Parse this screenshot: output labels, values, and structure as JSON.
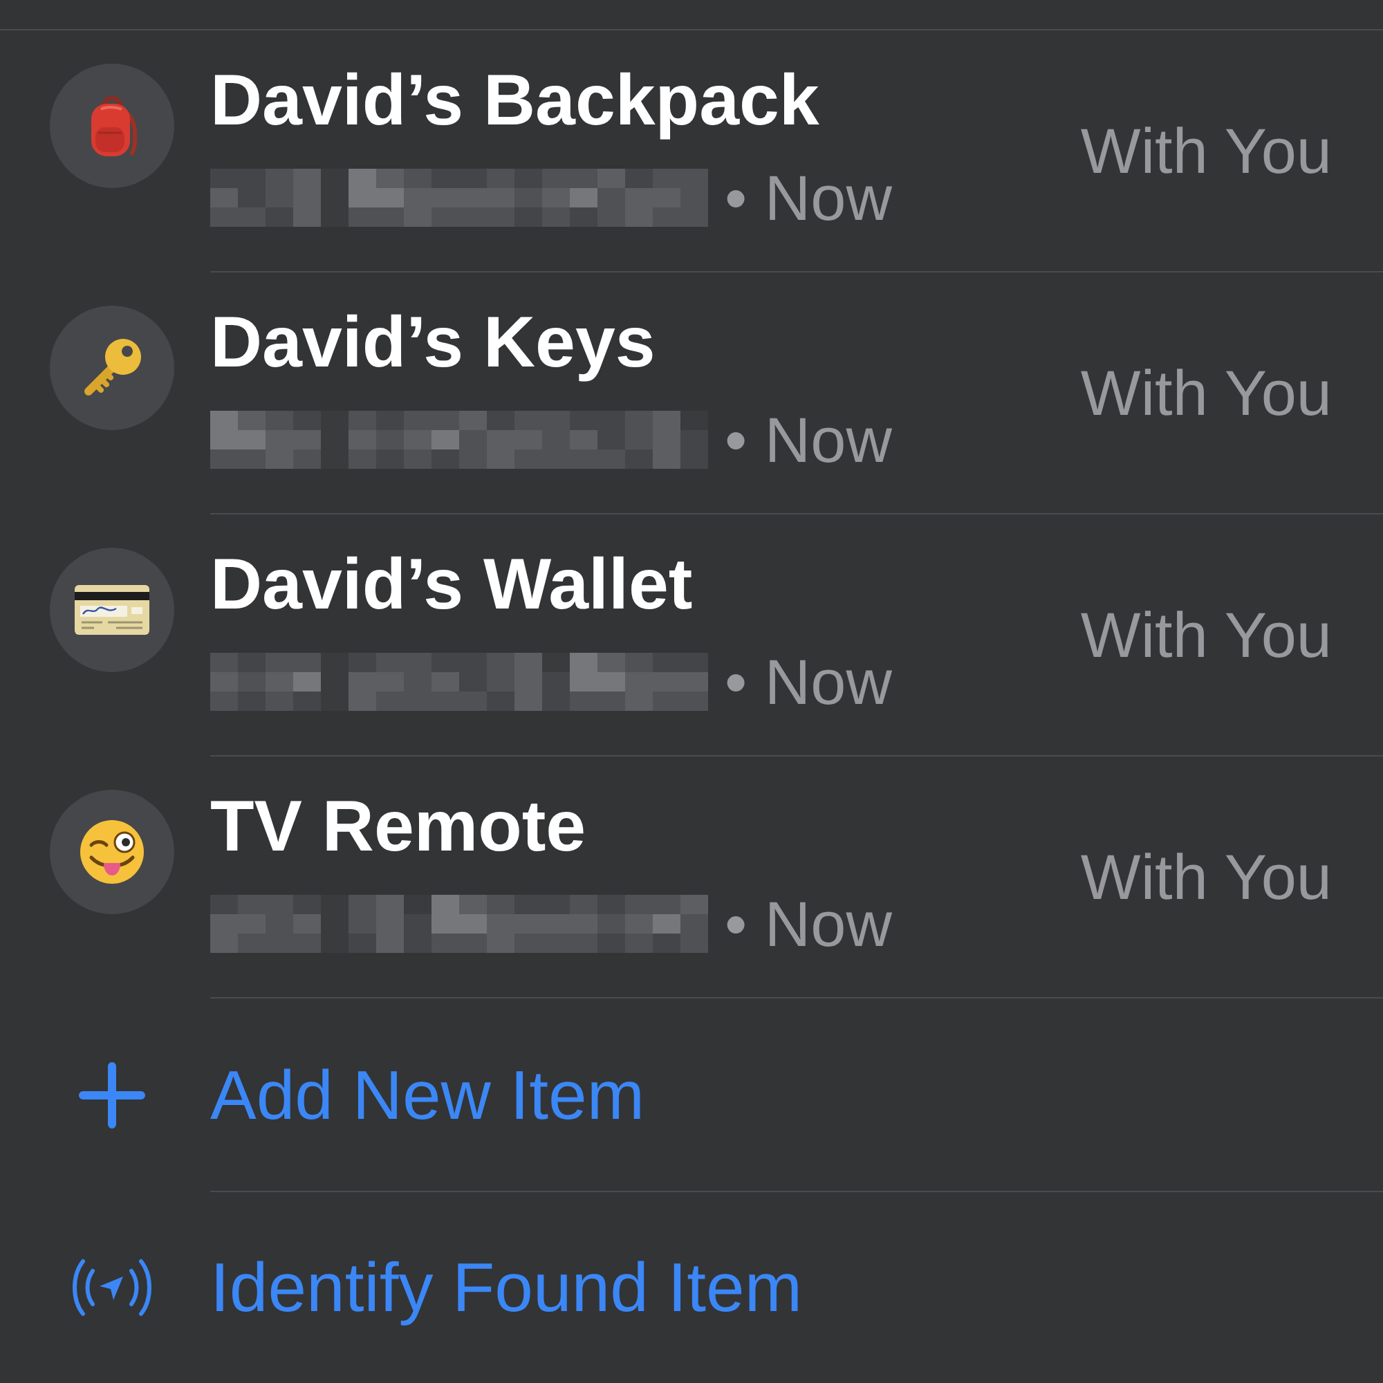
{
  "items": [
    {
      "kind": "backpack",
      "name": "David’s Backpack",
      "detail": "• Now",
      "status": "With You"
    },
    {
      "kind": "key",
      "name": "David’s Keys",
      "detail": "• Now",
      "status": "With You"
    },
    {
      "kind": "card",
      "name": "David’s Wallet",
      "detail": "• Now",
      "status": "With You"
    },
    {
      "kind": "emoji",
      "name": "TV Remote",
      "detail": "• Now",
      "status": "With You"
    }
  ],
  "actions": [
    {
      "kind": "add",
      "label": "Add New Item"
    },
    {
      "kind": "identify",
      "label": "Identify Found Item"
    }
  ]
}
